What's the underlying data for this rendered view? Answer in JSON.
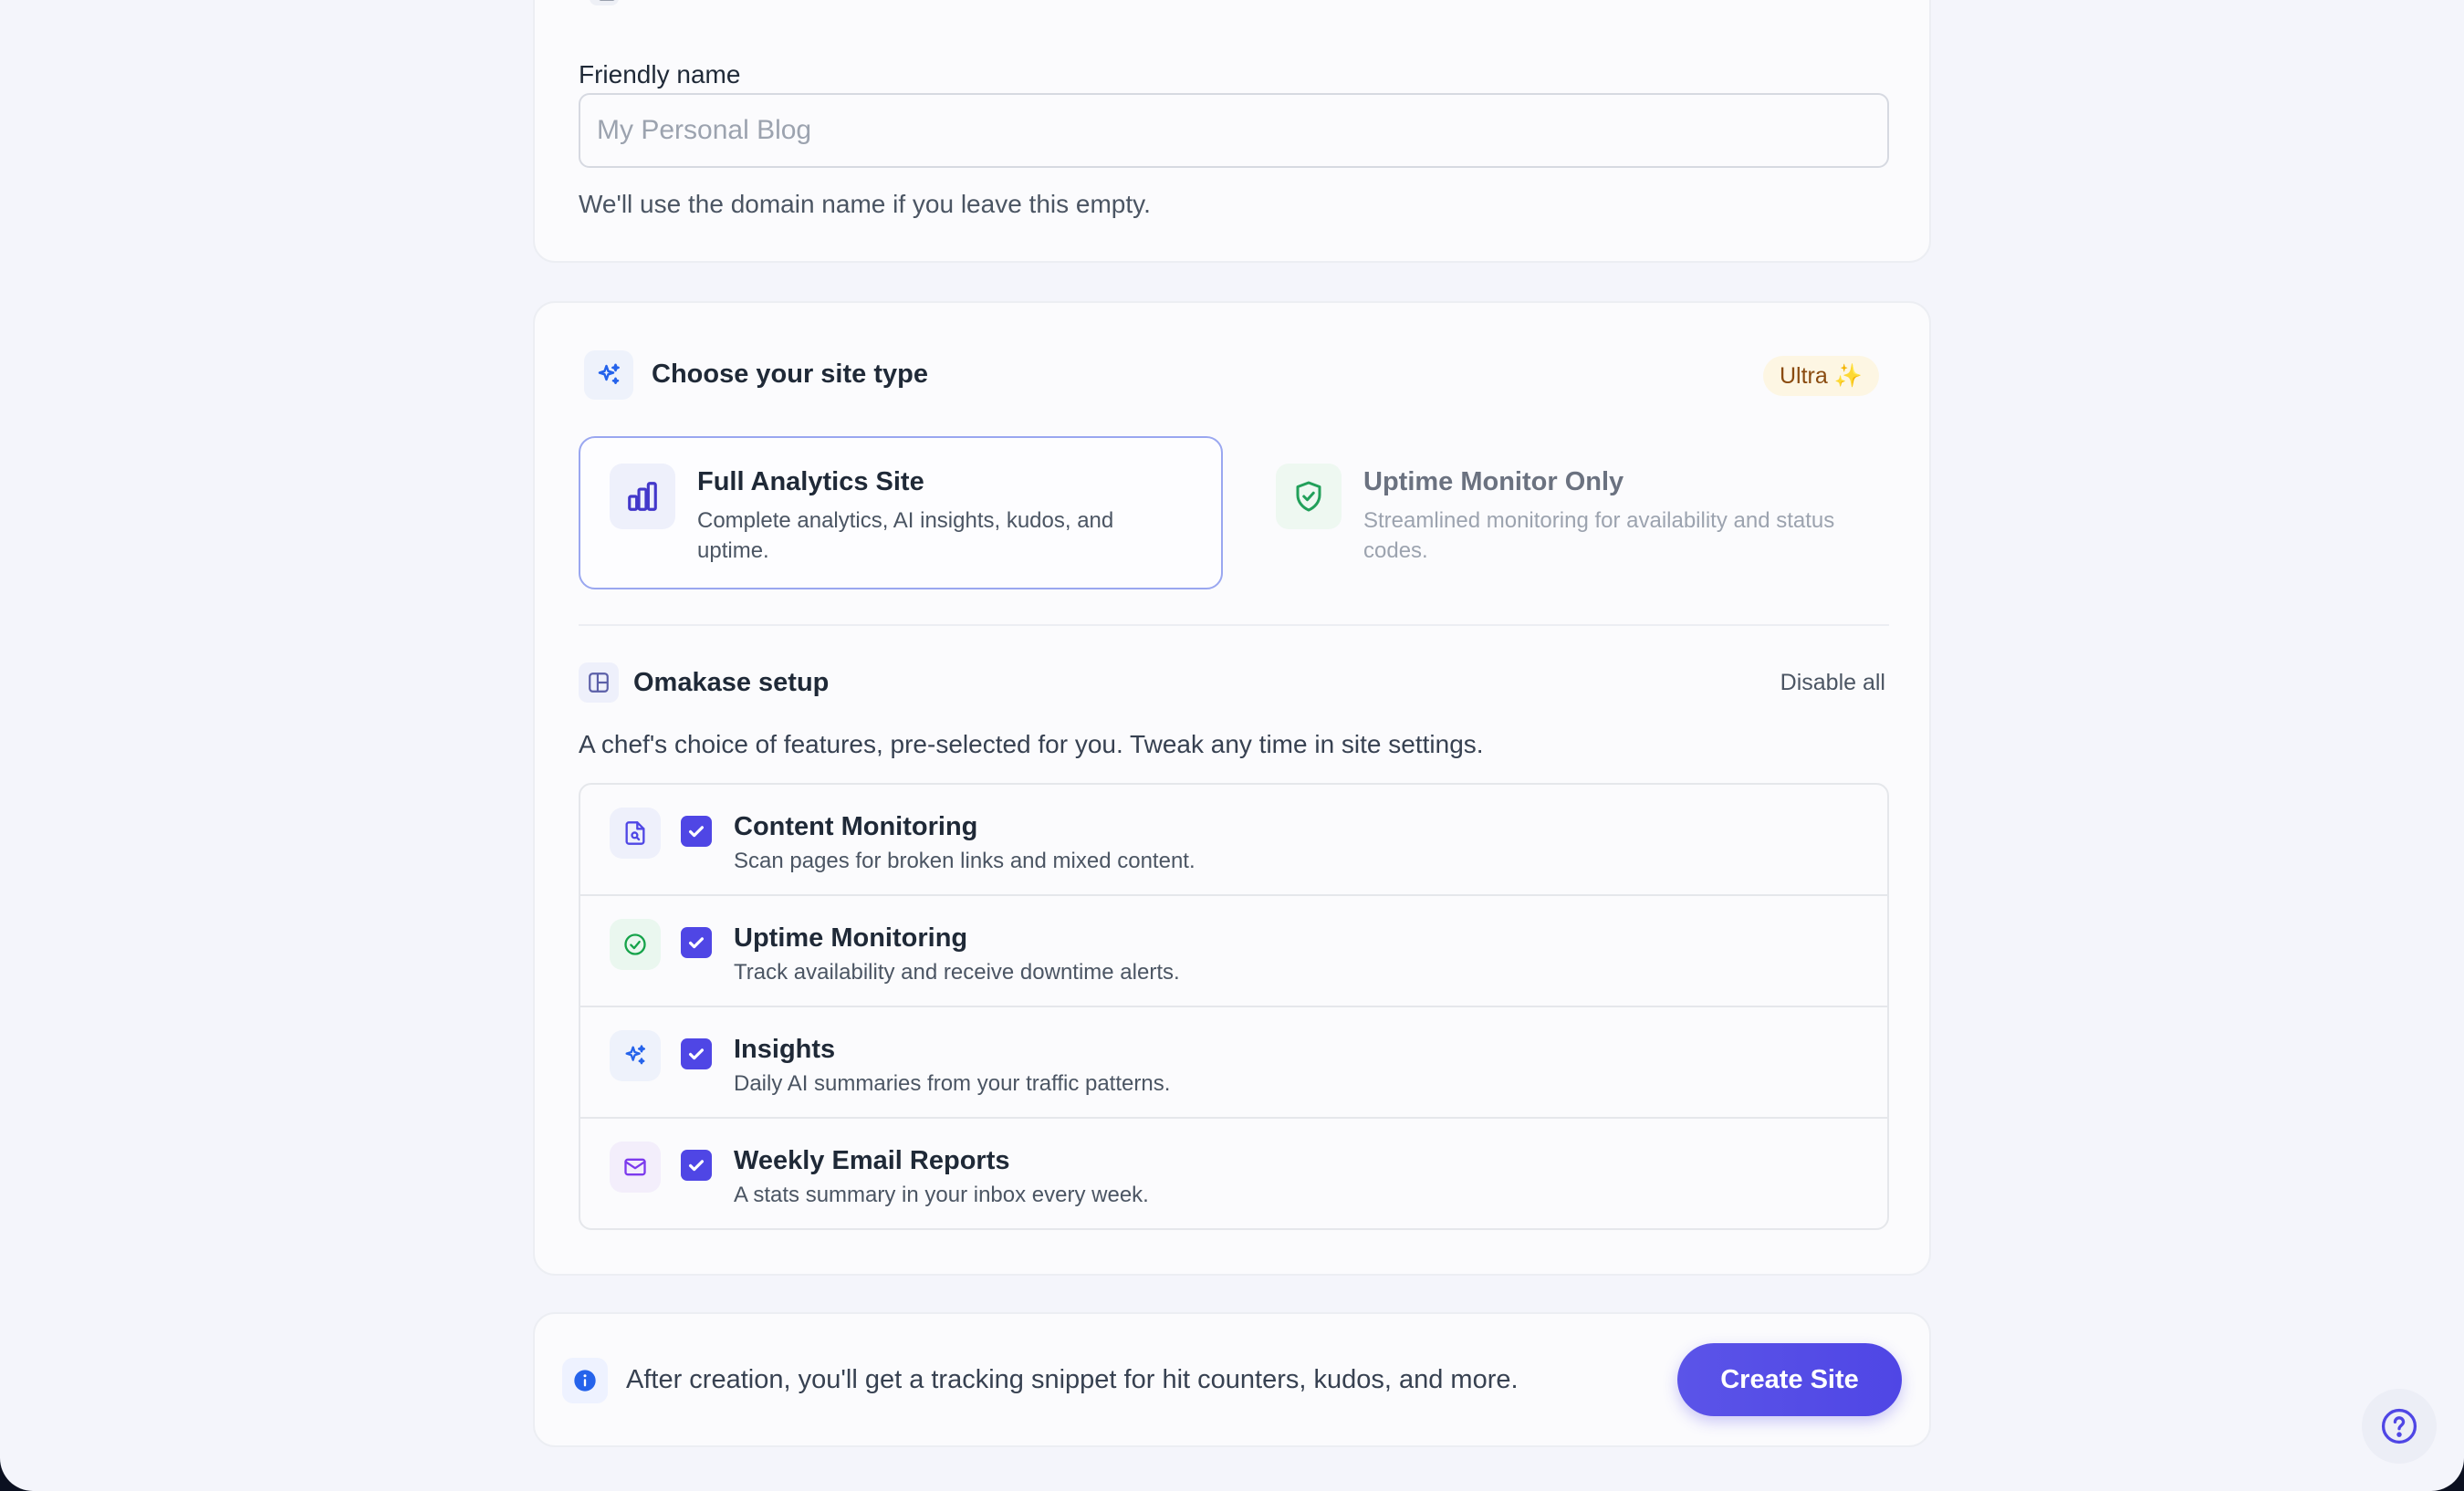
{
  "name_card": {
    "label": "Friendly name",
    "placeholder": "My Personal Blog",
    "value": "",
    "help": "We'll use the domain name if you leave this empty."
  },
  "type_card": {
    "title": "Choose your site type",
    "badge": "Ultra ✨",
    "options": [
      {
        "title": "Full Analytics Site",
        "description": "Complete analytics, AI insights, kudos, and uptime.",
        "selected": true,
        "icon": "bar-chart-icon"
      },
      {
        "title": "Uptime Monitor Only",
        "description": "Streamlined monitoring for availability and status codes.",
        "selected": false,
        "icon": "shield-check-icon"
      }
    ],
    "omakase": {
      "title": "Omakase setup",
      "disable_all": "Disable all",
      "description": "A chef's choice of features, pre-selected for you. Tweak any time in site settings.",
      "features": [
        {
          "title": "Content Monitoring",
          "description": "Scan pages for broken links and mixed content.",
          "checked": true,
          "icon": "document-search-icon"
        },
        {
          "title": "Uptime Monitoring",
          "description": "Track availability and receive downtime alerts.",
          "checked": true,
          "icon": "check-circle-icon"
        },
        {
          "title": "Insights",
          "description": "Daily AI summaries from your traffic patterns.",
          "checked": true,
          "icon": "sparkles-icon"
        },
        {
          "title": "Weekly Email Reports",
          "description": "A stats summary in your inbox every week.",
          "checked": true,
          "icon": "mail-icon"
        }
      ]
    }
  },
  "footer": {
    "info": "After creation, you'll get a tracking snippet for hit counters, kudos, and more.",
    "create_button": "Create Site"
  },
  "colors": {
    "accent": "#4f46e5",
    "page_bg": "#f4f5fb",
    "card_bg": "#fbfbfd",
    "badge_bg": "#fdf6e3",
    "badge_text": "#8a4b0f",
    "success": "#16a34a"
  }
}
